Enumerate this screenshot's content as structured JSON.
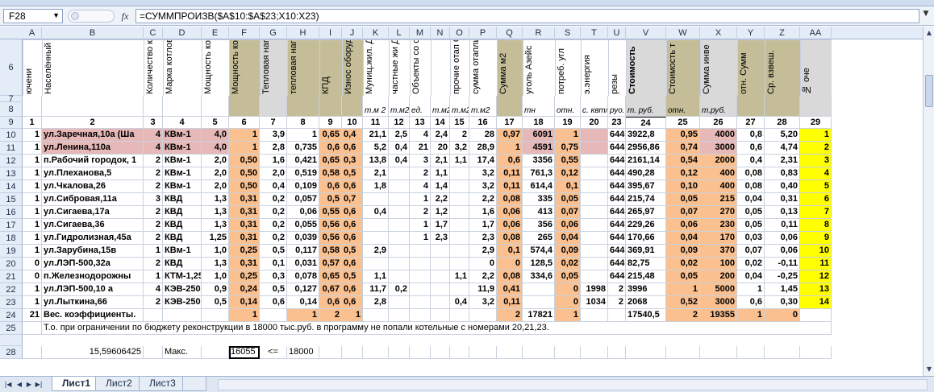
{
  "formula_bar": {
    "name_box": "F28",
    "formula": "=СУММПРОИЗВ($A$10:$A$23;X10:X23)"
  },
  "column_headers": [
    "A",
    "B",
    "C",
    "D",
    "E",
    "F",
    "G",
    "H",
    "I",
    "J",
    "K",
    "L",
    "M",
    "N",
    "O",
    "P",
    "Q",
    "R",
    "S",
    "T",
    "U",
    "V",
    "W",
    "X",
    "Y",
    "Z",
    "AA"
  ],
  "header_texts": {
    "a": "ючени",
    "b": "Населённый пункт,адрес кот",
    "c": "Количество кот",
    "d": "Марка котлов",
    "e": "Мощность кот Гкал/ч",
    "f": "Мощность кот отн.",
    "g": "Тепловая нагру Гкал/ч",
    "h": "тепловая нагру",
    "i": "КПД",
    "j": "Износ оборуд. Котельной %",
    "k": "Муниц.жил. Дома",
    "k_unit": "т.м 2",
    "l": "частные жи Дома",
    "m": "Объекты со сферы",
    "n": "",
    "o": "прочие отап Объекты",
    "p": "сумма отапливаем",
    "q": "Сумма м2",
    "r": "уголь Азейс",
    "s": "потреб. угл",
    "t": "э.энергия",
    "u": "резы",
    "v": "Стоимость",
    "w": "Стоимость т",
    "x": "Сумма инве",
    "y": "отн. Сумм",
    "z": "Ср. взвеш.",
    "aa": "№ оче"
  },
  "unit_row": {
    "l": "т.м2",
    "m": "ед.",
    "n": "т.м2",
    "o": "т.м2",
    "p": "т.м2",
    "r": "тн",
    "s": "отн.",
    "t": "с. квт/ч",
    "u": "руо.",
    "v": "т. руб.",
    "w": "отн.",
    "x": "т.руб."
  },
  "col_numbers": [
    "1",
    "2",
    "3",
    "4",
    "5",
    "6",
    "7",
    "8",
    "9",
    "10",
    "11",
    "12",
    "13",
    "14",
    "15",
    "16",
    "17",
    "18",
    "19",
    "20",
    "23",
    "24",
    "25",
    "26",
    "27",
    "28",
    "29"
  ],
  "rows": [
    {
      "rn": "10",
      "a": "1",
      "b": "ул.Заречная,10а (Ша",
      "c": "4",
      "d": "КВм-1",
      "e": "4,0",
      "f": "1",
      "g": "3,9",
      "h": "1",
      "i": "0,65",
      "j": "0,4",
      "k": "21,1",
      "l": "2,5",
      "m": "4",
      "n": "2,4",
      "o": "2",
      "p": "28",
      "q": "0,97",
      "r": "6091",
      "s": "1",
      "t": "",
      "u": "644",
      "v": "3922,8",
      "w": "0,95",
      "x": "4000",
      "y": "0,8",
      "z": "5,20",
      "aa": "1",
      "pink": true
    },
    {
      "rn": "11",
      "a": "1",
      "b": "ул.Ленина,110а",
      "c": "4",
      "d": "КВм-1",
      "e": "4,0",
      "f": "1",
      "g": "2,8",
      "h": "0,735",
      "i": "0,6",
      "j": "0,6",
      "k": "5,2",
      "l": "0,4",
      "m": "21",
      "n": "20",
      "o": "3,2",
      "p": "28,9",
      "q": "1",
      "r": "4591",
      "s": "0,75",
      "t": "",
      "u": "644",
      "v": "2956,86",
      "w": "0,74",
      "x": "3000",
      "y": "0,6",
      "z": "4,74",
      "aa": "2",
      "pink": true
    },
    {
      "rn": "12",
      "a": "1",
      "b": "п.Рабочий городок, 1",
      "c": "2",
      "d": "КВм-1",
      "e": "2,0",
      "f": "0,50",
      "g": "1,6",
      "h": "0,421",
      "i": "0,65",
      "j": "0,3",
      "k": "13,8",
      "l": "0,4",
      "m": "3",
      "n": "2,1",
      "o": "1,1",
      "p": "17,4",
      "q": "0,6",
      "r": "3356",
      "s": "0,55",
      "t": "",
      "u": "644",
      "v": "2161,14",
      "w": "0,54",
      "x": "2000",
      "y": "0,4",
      "z": "2,31",
      "aa": "3"
    },
    {
      "rn": "13",
      "a": "1",
      "b": "ул.Плеханова,5",
      "c": "2",
      "d": "КВм-1",
      "e": "2,0",
      "f": "0,50",
      "g": "2,0",
      "h": "0,519",
      "i": "0,58",
      "j": "0,5",
      "k": "2,1",
      "l": "",
      "m": "2",
      "n": "1,1",
      "o": "",
      "p": "3,2",
      "q": "0,11",
      "r": "761,3",
      "s": "0,12",
      "t": "",
      "u": "644",
      "v": "490,28",
      "w": "0,12",
      "x": "400",
      "y": "0,08",
      "z": "0,83",
      "aa": "4"
    },
    {
      "rn": "14",
      "a": "1",
      "b": "ул.Чкалова,26",
      "c": "2",
      "d": "КВм-1",
      "e": "2,0",
      "f": "0,50",
      "g": "0,4",
      "h": "0,109",
      "i": "0,6",
      "j": "0,6",
      "k": "1,8",
      "l": "",
      "m": "4",
      "n": "1,4",
      "o": "",
      "p": "3,2",
      "q": "0,11",
      "r": "614,4",
      "s": "0,1",
      "t": "",
      "u": "644",
      "v": "395,67",
      "w": "0,10",
      "x": "400",
      "y": "0,08",
      "z": "0,40",
      "aa": "5"
    },
    {
      "rn": "15",
      "a": "1",
      "b": "ул.Сибровая,11а",
      "c": "3",
      "d": "КВД",
      "e": "1,3",
      "f": "0,31",
      "g": "0,2",
      "h": "0,057",
      "i": "0,5",
      "j": "0,7",
      "k": "",
      "l": "",
      "m": "1",
      "n": "2,2",
      "o": "",
      "p": "2,2",
      "q": "0,08",
      "r": "335",
      "s": "0,05",
      "t": "",
      "u": "644",
      "v": "215,74",
      "w": "0,05",
      "x": "215",
      "y": "0,04",
      "z": "0,31",
      "aa": "6"
    },
    {
      "rn": "16",
      "a": "1",
      "b": "ул.Сигаева,17а",
      "c": "2",
      "d": "КВД",
      "e": "1,3",
      "f": "0,31",
      "g": "0,2",
      "h": "0,06",
      "i": "0,55",
      "j": "0,6",
      "k": "0,4",
      "l": "",
      "m": "2",
      "n": "1,2",
      "o": "",
      "p": "1,6",
      "q": "0,06",
      "r": "413",
      "s": "0,07",
      "t": "",
      "u": "644",
      "v": "265,97",
      "w": "0,07",
      "x": "270",
      "y": "0,05",
      "z": "0,13",
      "aa": "7"
    },
    {
      "rn": "17",
      "a": "1",
      "b": "ул.Сигаева,36",
      "c": "2",
      "d": "КВД",
      "e": "1,3",
      "f": "0,31",
      "g": "0,2",
      "h": "0,055",
      "i": "0,56",
      "j": "0,6",
      "k": "",
      "l": "",
      "m": "1",
      "n": "1,7",
      "o": "",
      "p": "1,7",
      "q": "0,06",
      "r": "356",
      "s": "0,06",
      "t": "",
      "u": "644",
      "v": "229,26",
      "w": "0,06",
      "x": "230",
      "y": "0,05",
      "z": "0,11",
      "aa": "8"
    },
    {
      "rn": "18",
      "a": "1",
      "b": "ул.Гидролизная,45а",
      "c": "2",
      "d": "КВД",
      "e": "1,25",
      "f": "0,31",
      "g": "0,2",
      "h": "0,039",
      "i": "0,56",
      "j": "0,6",
      "k": "",
      "l": "",
      "m": "1",
      "n": "2,3",
      "o": "",
      "p": "2,3",
      "q": "0,08",
      "r": "265",
      "s": "0,04",
      "t": "",
      "u": "644",
      "v": "170,66",
      "w": "0,04",
      "x": "170",
      "y": "0,03",
      "z": "0,06",
      "aa": "9"
    },
    {
      "rn": "19",
      "a": "1",
      "b": "ул.Зарубина,15в",
      "c": "1",
      "d": "КВм-1",
      "e": "1,0",
      "f": "0,25",
      "g": "0,5",
      "h": "0,117",
      "i": "0,58",
      "j": "0,5",
      "k": "2,9",
      "l": "",
      "m": "",
      "n": "",
      "o": "",
      "p": "2,9",
      "q": "0,1",
      "r": "574,4",
      "s": "0,09",
      "t": "",
      "u": "644",
      "v": "369,91",
      "w": "0,09",
      "x": "370",
      "y": "0,07",
      "z": "0,06",
      "aa": "10"
    },
    {
      "rn": "20",
      "a": "0",
      "b": "ул.ЛЭП-500,32а",
      "c": "2",
      "d": "КВД",
      "e": "1,3",
      "f": "0,31",
      "g": "0,1",
      "h": "0,031",
      "i": "0,57",
      "j": "0,6",
      "k": "",
      "l": "",
      "m": "",
      "n": "",
      "o": "",
      "p": "0",
      "q": "0",
      "r": "128,5",
      "s": "0,02",
      "t": "",
      "u": "644",
      "v": "82,75",
      "w": "0,02",
      "x": "100",
      "y": "0,02",
      "z": "-0,11",
      "aa": "11"
    },
    {
      "rn": "21",
      "a": "0",
      "b": "п.Железнодорожны",
      "c": "1",
      "d": "КТМ-1,25",
      "e": "1,0",
      "f": "0,25",
      "g": "0,3",
      "h": "0,078",
      "i": "0,65",
      "j": "0,5",
      "k": "1,1",
      "l": "",
      "m": "",
      "n": "",
      "o": "1,1",
      "p": "2,2",
      "q": "0,08",
      "r": "334,6",
      "s": "0,05",
      "t": "",
      "u": "644",
      "v": "215,48",
      "w": "0,05",
      "x": "200",
      "y": "0,04",
      "z": "-0,25",
      "aa": "12"
    },
    {
      "rn": "22",
      "a": "1",
      "b": "ул.ЛЭП-500,10 а",
      "c": "4",
      "d": "КЭВ-250",
      "e": "0,9",
      "f": "0,24",
      "g": "0,5",
      "h": "0,127",
      "i": "0,67",
      "j": "0,6",
      "k": "11,7",
      "l": "0,2",
      "m": "",
      "n": "",
      "o": "",
      "p": "11,9",
      "q": "0,41",
      "r": "",
      "s": "0",
      "t": "1998",
      "u": "2",
      "v": "3996",
      "w": "1",
      "x": "5000",
      "y": "1",
      "z": "1,45",
      "aa": "13"
    },
    {
      "rn": "23",
      "a": "1",
      "b": "ул.Лыткина,66",
      "c": "2",
      "d": "КЭВ-250",
      "e": "0,5",
      "f": "0,14",
      "g": "0,6",
      "h": "0,14",
      "i": "0,6",
      "j": "0,6",
      "k": "2,8",
      "l": "",
      "m": "",
      "n": "",
      "o": "0,4",
      "p": "3,2",
      "q": "0,11",
      "r": "",
      "s": "0",
      "t": "1034",
      "u": "2",
      "v": "2068",
      "w": "0,52",
      "x": "3000",
      "y": "0,6",
      "z": "0,30",
      "aa": "14"
    }
  ],
  "row24": {
    "rn": "24",
    "a": "21",
    "b": "Вес. коэффициенты.",
    "f": "1",
    "h": "1",
    "i": "2",
    "j": "1",
    "q": "2",
    "r": "17821",
    "s": "1",
    "v": "17540,5",
    "w": "2",
    "x": "19355",
    "y": "1",
    "z": "0"
  },
  "row25": {
    "rn": "25",
    "text": "Т.о. при ограничении по бюджету реконструкции в 18000 тыс.руб. в программу не попали котельные с номерами 20,21,23."
  },
  "row28": {
    "rn": "28",
    "b": "15,59606425",
    "d": "Макс.",
    "f": "16055",
    "g": "<=",
    "h": "18000"
  },
  "sheet_tabs": [
    "Лист1",
    "Лист2",
    "Лист3"
  ],
  "colors": {
    "pink": "#e6b8b7",
    "peach": "#fac090",
    "olive": "#c4bd97",
    "yellow": "#ffff00"
  }
}
